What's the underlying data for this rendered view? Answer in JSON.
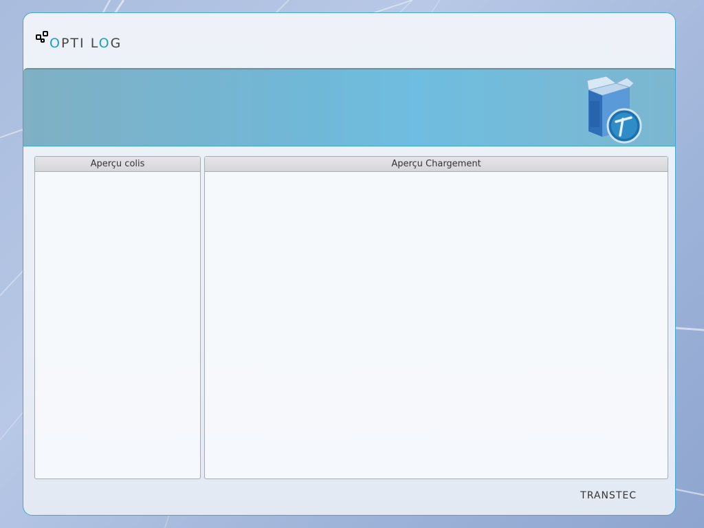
{
  "app": {
    "logo_text_accent_1": "O",
    "logo_text_dark_1": "PTI",
    "logo_text_accent_2": "L",
    "logo_text_accent_3": "O",
    "logo_text_dark_2": "G",
    "brand_footer": "TRANSTEC"
  },
  "panels": {
    "left_title": "Aperçu colis",
    "right_title": "Aperçu Chargement"
  },
  "colors": {
    "accent": "#1d9ec9",
    "frame_border": "#3fa6d9",
    "banner": "#70b8d8"
  },
  "icons": {
    "banner": "package-box-logo-icon",
    "logo": "optilog-dots-icon"
  }
}
